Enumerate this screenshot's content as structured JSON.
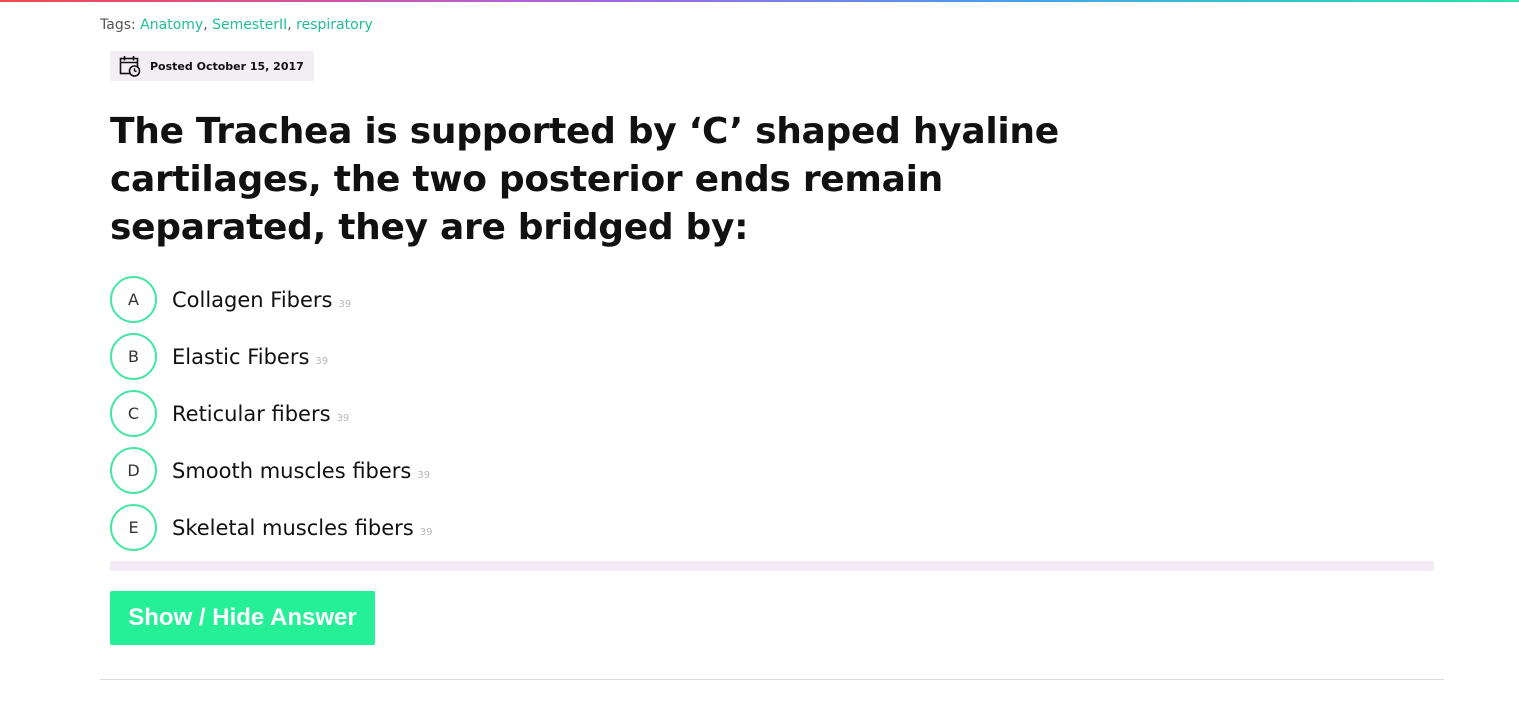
{
  "tags": {
    "label": "Tags:",
    "items": [
      "Anatomy",
      "SemesterII",
      "respiratory"
    ]
  },
  "posted": {
    "icon": "calendar-clock-icon",
    "text": "Posted October 15, 2017"
  },
  "question": "The Trachea is supported by ‘C’ shaped hyaline cartilages, the two posterior ends remain separated, they are bridged by:",
  "options": [
    {
      "letter": "A",
      "text": "Collagen Fibers",
      "count": "39"
    },
    {
      "letter": "B",
      "text": "Elastic Fibers",
      "count": "39"
    },
    {
      "letter": "C",
      "text": "Reticular fibers",
      "count": "39"
    },
    {
      "letter": "D",
      "text": "Smooth muscles fibers",
      "count": "39"
    },
    {
      "letter": "E",
      "text": "Skeletal muscles fibers",
      "count": "39"
    }
  ],
  "toggle_button": "Show / Hide Answer",
  "colors": {
    "accent": "#25f097",
    "tag_link": "#1fbf9a",
    "option_ring": "#43e6a3"
  }
}
